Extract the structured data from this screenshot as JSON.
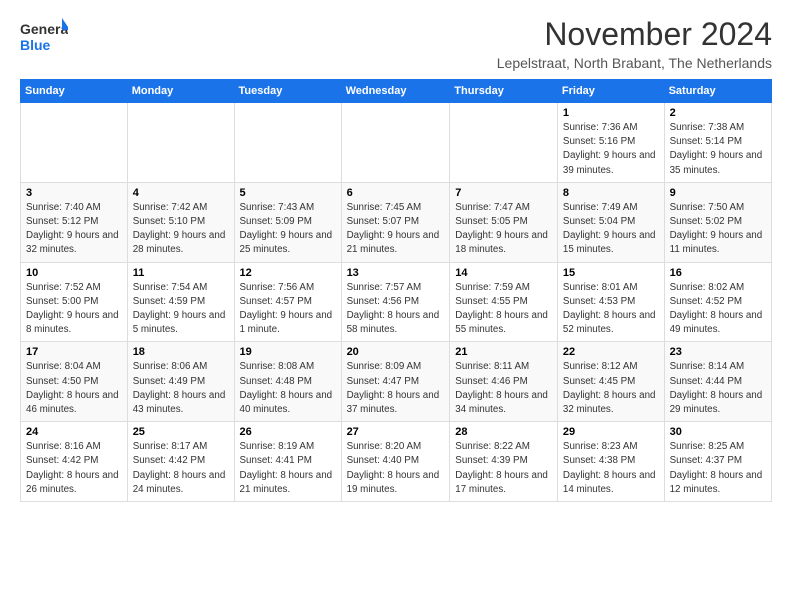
{
  "logo": {
    "general": "General",
    "blue": "Blue"
  },
  "header": {
    "month_title": "November 2024",
    "subtitle": "Lepelstraat, North Brabant, The Netherlands"
  },
  "weekdays": [
    "Sunday",
    "Monday",
    "Tuesday",
    "Wednesday",
    "Thursday",
    "Friday",
    "Saturday"
  ],
  "weeks": [
    [
      {
        "day": "",
        "info": ""
      },
      {
        "day": "",
        "info": ""
      },
      {
        "day": "",
        "info": ""
      },
      {
        "day": "",
        "info": ""
      },
      {
        "day": "",
        "info": ""
      },
      {
        "day": "1",
        "info": "Sunrise: 7:36 AM\nSunset: 5:16 PM\nDaylight: 9 hours and 39 minutes."
      },
      {
        "day": "2",
        "info": "Sunrise: 7:38 AM\nSunset: 5:14 PM\nDaylight: 9 hours and 35 minutes."
      }
    ],
    [
      {
        "day": "3",
        "info": "Sunrise: 7:40 AM\nSunset: 5:12 PM\nDaylight: 9 hours and 32 minutes."
      },
      {
        "day": "4",
        "info": "Sunrise: 7:42 AM\nSunset: 5:10 PM\nDaylight: 9 hours and 28 minutes."
      },
      {
        "day": "5",
        "info": "Sunrise: 7:43 AM\nSunset: 5:09 PM\nDaylight: 9 hours and 25 minutes."
      },
      {
        "day": "6",
        "info": "Sunrise: 7:45 AM\nSunset: 5:07 PM\nDaylight: 9 hours and 21 minutes."
      },
      {
        "day": "7",
        "info": "Sunrise: 7:47 AM\nSunset: 5:05 PM\nDaylight: 9 hours and 18 minutes."
      },
      {
        "day": "8",
        "info": "Sunrise: 7:49 AM\nSunset: 5:04 PM\nDaylight: 9 hours and 15 minutes."
      },
      {
        "day": "9",
        "info": "Sunrise: 7:50 AM\nSunset: 5:02 PM\nDaylight: 9 hours and 11 minutes."
      }
    ],
    [
      {
        "day": "10",
        "info": "Sunrise: 7:52 AM\nSunset: 5:00 PM\nDaylight: 9 hours and 8 minutes."
      },
      {
        "day": "11",
        "info": "Sunrise: 7:54 AM\nSunset: 4:59 PM\nDaylight: 9 hours and 5 minutes."
      },
      {
        "day": "12",
        "info": "Sunrise: 7:56 AM\nSunset: 4:57 PM\nDaylight: 9 hours and 1 minute."
      },
      {
        "day": "13",
        "info": "Sunrise: 7:57 AM\nSunset: 4:56 PM\nDaylight: 8 hours and 58 minutes."
      },
      {
        "day": "14",
        "info": "Sunrise: 7:59 AM\nSunset: 4:55 PM\nDaylight: 8 hours and 55 minutes."
      },
      {
        "day": "15",
        "info": "Sunrise: 8:01 AM\nSunset: 4:53 PM\nDaylight: 8 hours and 52 minutes."
      },
      {
        "day": "16",
        "info": "Sunrise: 8:02 AM\nSunset: 4:52 PM\nDaylight: 8 hours and 49 minutes."
      }
    ],
    [
      {
        "day": "17",
        "info": "Sunrise: 8:04 AM\nSunset: 4:50 PM\nDaylight: 8 hours and 46 minutes."
      },
      {
        "day": "18",
        "info": "Sunrise: 8:06 AM\nSunset: 4:49 PM\nDaylight: 8 hours and 43 minutes."
      },
      {
        "day": "19",
        "info": "Sunrise: 8:08 AM\nSunset: 4:48 PM\nDaylight: 8 hours and 40 minutes."
      },
      {
        "day": "20",
        "info": "Sunrise: 8:09 AM\nSunset: 4:47 PM\nDaylight: 8 hours and 37 minutes."
      },
      {
        "day": "21",
        "info": "Sunrise: 8:11 AM\nSunset: 4:46 PM\nDaylight: 8 hours and 34 minutes."
      },
      {
        "day": "22",
        "info": "Sunrise: 8:12 AM\nSunset: 4:45 PM\nDaylight: 8 hours and 32 minutes."
      },
      {
        "day": "23",
        "info": "Sunrise: 8:14 AM\nSunset: 4:44 PM\nDaylight: 8 hours and 29 minutes."
      }
    ],
    [
      {
        "day": "24",
        "info": "Sunrise: 8:16 AM\nSunset: 4:42 PM\nDaylight: 8 hours and 26 minutes."
      },
      {
        "day": "25",
        "info": "Sunrise: 8:17 AM\nSunset: 4:42 PM\nDaylight: 8 hours and 24 minutes."
      },
      {
        "day": "26",
        "info": "Sunrise: 8:19 AM\nSunset: 4:41 PM\nDaylight: 8 hours and 21 minutes."
      },
      {
        "day": "27",
        "info": "Sunrise: 8:20 AM\nSunset: 4:40 PM\nDaylight: 8 hours and 19 minutes."
      },
      {
        "day": "28",
        "info": "Sunrise: 8:22 AM\nSunset: 4:39 PM\nDaylight: 8 hours and 17 minutes."
      },
      {
        "day": "29",
        "info": "Sunrise: 8:23 AM\nSunset: 4:38 PM\nDaylight: 8 hours and 14 minutes."
      },
      {
        "day": "30",
        "info": "Sunrise: 8:25 AM\nSunset: 4:37 PM\nDaylight: 8 hours and 12 minutes."
      }
    ]
  ]
}
